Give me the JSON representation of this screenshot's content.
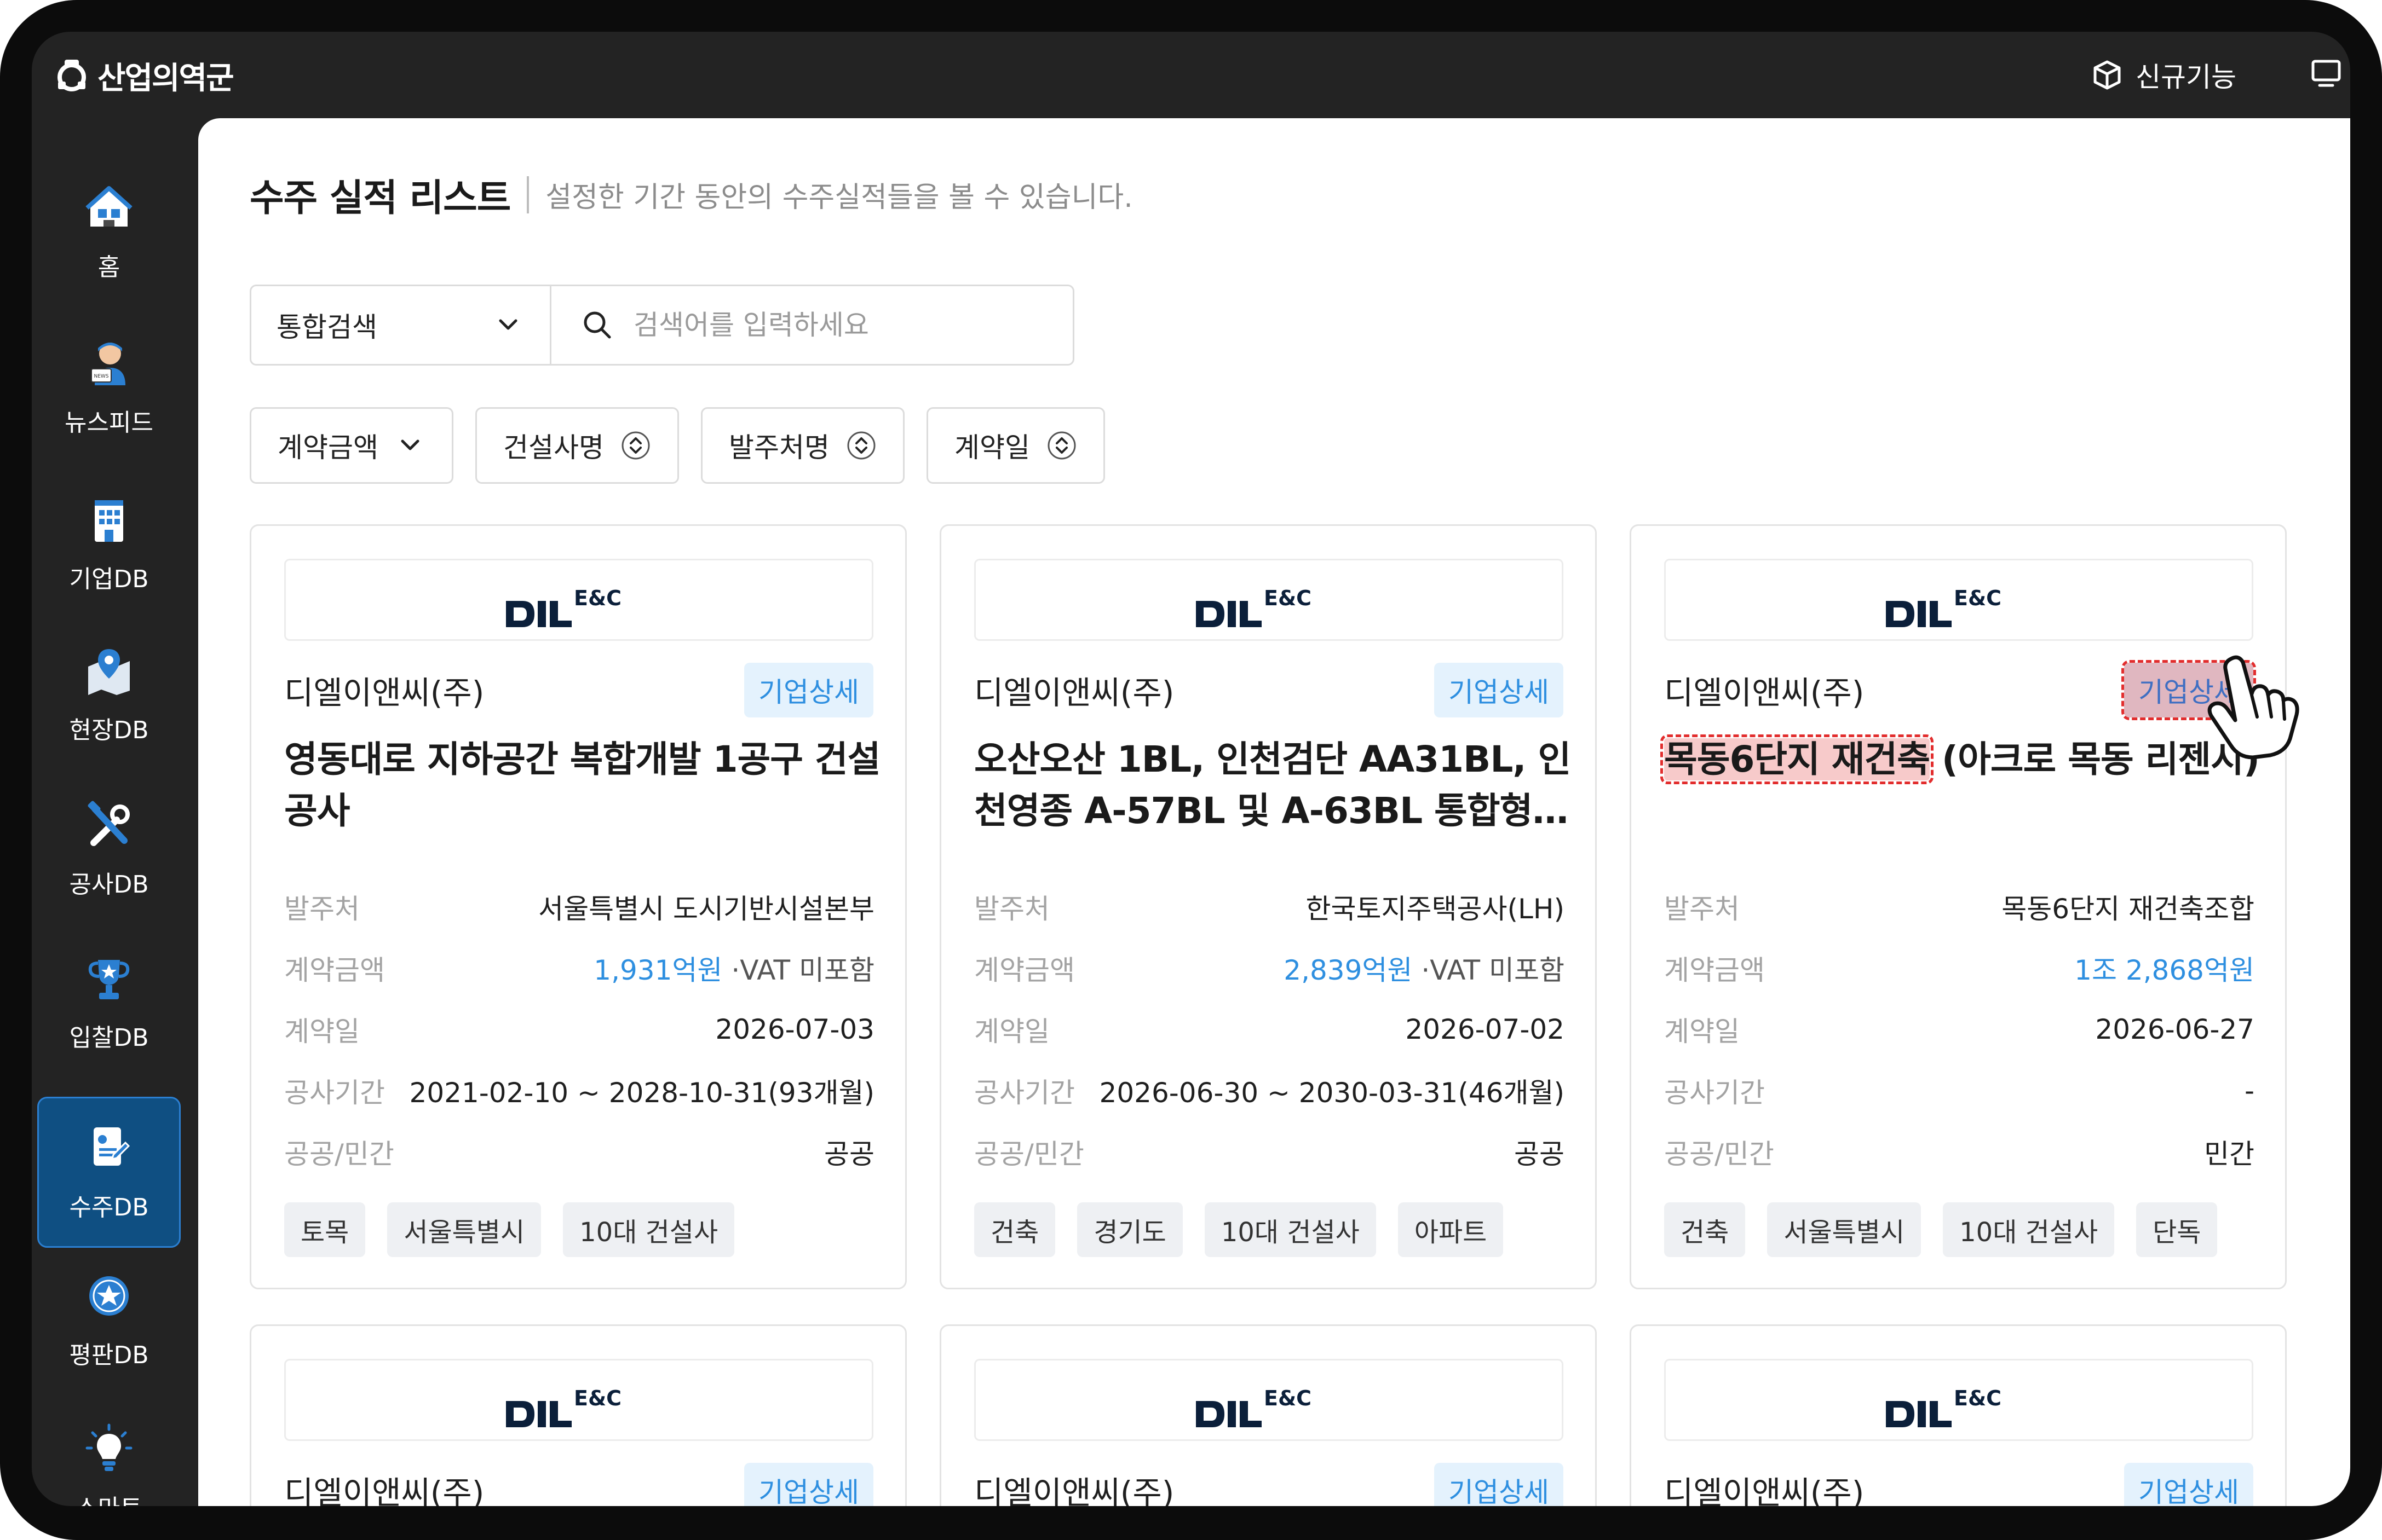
{
  "app": {
    "logo_text": "산업의역군",
    "new_features_label": "신규기능"
  },
  "sidebar": {
    "items": [
      {
        "label": "홈",
        "icon": "home-icon"
      },
      {
        "label": "뉴스피드",
        "icon": "newsfeed-icon"
      },
      {
        "label": "기업DB",
        "icon": "building-icon"
      },
      {
        "label": "현장DB",
        "icon": "map-pin-icon"
      },
      {
        "label": "공사DB",
        "icon": "tools-icon"
      },
      {
        "label": "입찰DB",
        "icon": "trophy-icon"
      },
      {
        "label": "수주DB",
        "icon": "contract-icon",
        "active": true
      },
      {
        "label": "평판DB",
        "icon": "star-badge-icon"
      },
      {
        "label": "스마트",
        "icon": "lightbulb-icon"
      }
    ]
  },
  "page": {
    "title": "수주 실적 리스트",
    "description": "설정한 기간 동안의 수주실적들을 볼 수 있습니다."
  },
  "search": {
    "scope": "통합검색",
    "placeholder": "검색어를 입력하세요"
  },
  "filters": [
    "계약금액",
    "건설사명",
    "발주처명",
    "계약일"
  ],
  "labels": {
    "client": "발주처",
    "amount": "계약금액",
    "date": "계약일",
    "period": "공사기간",
    "sector": "공공/민간",
    "detail_button": "기업상세"
  },
  "cards": [
    {
      "logo": "DL E&C",
      "company": "디엘이앤씨(주)",
      "title": "영동대로 지하공간 복합개발 1공구 건설공사",
      "client": "서울특별시 도시기반시설본부",
      "amount": "1,931억원",
      "vat": "·VAT 미포함",
      "date": "2026-07-03",
      "period": "2021-02-10 ~ 2028-10-31(93개월)",
      "sector": "공공",
      "tags": [
        "토목",
        "서울특별시",
        "10대 건설사"
      ]
    },
    {
      "logo": "DL E&C",
      "company": "디엘이앤씨(주)",
      "title": "오산오산 1BL, 인천검단 AA31BL, 인천영종 A-57BL 및 A-63BL 통합형 …",
      "client": "한국토지주택공사(LH)",
      "amount": "2,839억원",
      "vat": "·VAT 미포함",
      "date": "2026-07-02",
      "period": "2026-06-30 ~ 2030-03-31(46개월)",
      "sector": "공공",
      "tags": [
        "건축",
        "경기도",
        "10대 건설사",
        "아파트"
      ]
    },
    {
      "logo": "DL E&C",
      "company": "디엘이앤씨(주)",
      "title_highlight": "목동6단지 재건축",
      "title_rest": " (아크로 목동 리젠시)",
      "client": "목동6단지 재건축조합",
      "amount": "1조 2,868억원",
      "vat": "",
      "date": "2026-06-27",
      "period": "-",
      "sector": "민간",
      "tags": [
        "건축",
        "서울특별시",
        "10대 건설사",
        "단독"
      ]
    },
    {
      "logo": "DL E&C",
      "company": "디엘이앤씨(주)"
    },
    {
      "logo": "DL E&C",
      "company": "디엘이앤씨(주)"
    },
    {
      "logo": "DL E&C",
      "company": "디엘이앤씨(주)"
    }
  ],
  "colors": {
    "accent": "#2e8fe0",
    "sidebar_active": "#0f4f82",
    "highlight_border": "#e22d2d"
  }
}
